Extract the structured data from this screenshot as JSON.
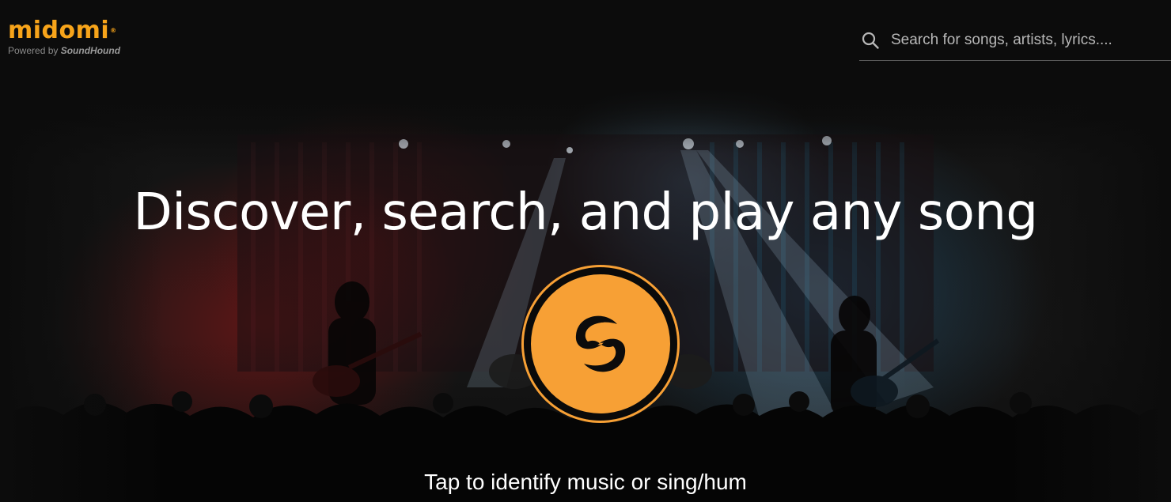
{
  "header": {
    "logo_text": "midomi",
    "logo_registered": "®",
    "powered_prefix": "Powered by",
    "powered_brand": "SoundHound"
  },
  "search": {
    "placeholder": "Search for songs, artists, lyrics....",
    "value": "",
    "icon": "search-icon"
  },
  "hero": {
    "headline": "Discover, search, and play any song",
    "button_icon": "soundhound-logo-icon",
    "tap_text": "Tap to identify music or sing/hum"
  },
  "colors": {
    "brand_orange": "#f7a035",
    "background": "#0c0c0c",
    "text": "#ffffff"
  }
}
